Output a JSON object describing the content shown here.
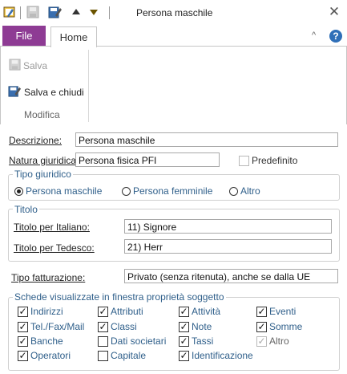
{
  "window": {
    "title": "Persona maschile",
    "close_glyph": "✕"
  },
  "ribbon": {
    "tabs": {
      "file": "File",
      "home": "Home"
    },
    "caret_glyph": "^",
    "help_glyph": "?",
    "buttons": {
      "save": "Salva",
      "save_close": "Salva e chiudi"
    },
    "group_label": "Modifica"
  },
  "form": {
    "descrizione": {
      "label": "Descrizione:",
      "value": "Persona maschile"
    },
    "natura": {
      "label": "Natura giuridica:",
      "value": "Persona fisica PFI"
    },
    "predefinito": {
      "label": "Predefinito",
      "checked": false
    },
    "tipo_giuridico": {
      "title": "Tipo giuridico",
      "options": [
        {
          "label": "Persona maschile",
          "selected": true
        },
        {
          "label": "Persona femminile",
          "selected": false
        },
        {
          "label": "Altro",
          "selected": false
        }
      ]
    },
    "titolo": {
      "title": "Titolo",
      "italiano": {
        "label": "Titolo per Italiano:",
        "value": "11) Signore"
      },
      "tedesco": {
        "label": "Titolo per Tedesco:",
        "value": "21) Herr"
      }
    },
    "fatturazione": {
      "label": "Tipo fatturazione:",
      "value": "Privato (senza ritenuta), anche se dalla UE"
    },
    "schede": {
      "title": "Schede visualizzate in finestra proprietà soggetto",
      "items": [
        {
          "label": "Indirizzi",
          "checked": true
        },
        {
          "label": "Attributi",
          "checked": true
        },
        {
          "label": "Attività",
          "checked": true
        },
        {
          "label": "Eventi",
          "checked": true
        },
        {
          "label": "Tel./Fax/Mail",
          "checked": true
        },
        {
          "label": "Classi",
          "checked": true
        },
        {
          "label": "Note",
          "checked": true
        },
        {
          "label": "Somme",
          "checked": true
        },
        {
          "label": "Banche",
          "checked": true
        },
        {
          "label": "Dati societari",
          "checked": false
        },
        {
          "label": "Tassi",
          "checked": true
        },
        {
          "label": "Altro",
          "checked": true,
          "disabled": true
        },
        {
          "label": "Operatori",
          "checked": true
        },
        {
          "label": "Capitale",
          "checked": false
        },
        {
          "label": "Identificazione",
          "checked": true
        }
      ]
    }
  }
}
